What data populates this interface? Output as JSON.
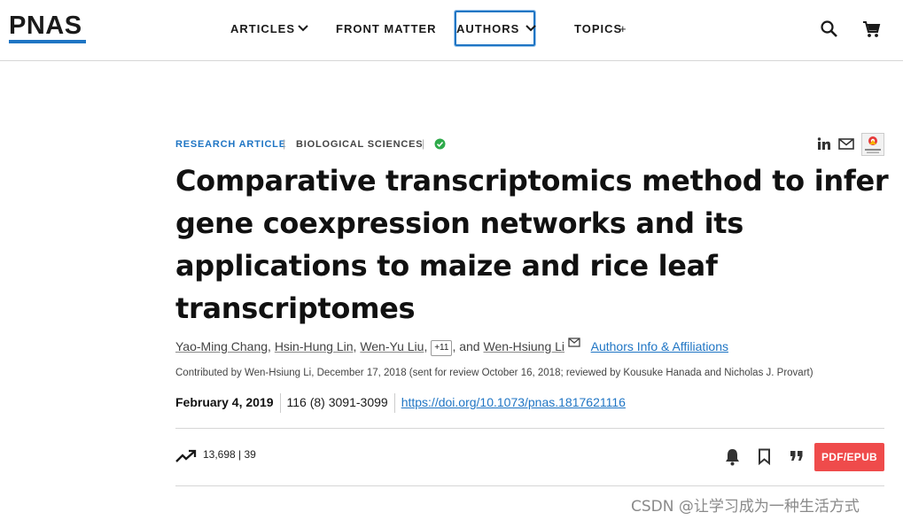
{
  "header": {
    "logo": "PNAS",
    "nav": [
      {
        "label": "ARTICLES"
      },
      {
        "label": "FRONT MATTER"
      },
      {
        "label": "AUTHORS"
      },
      {
        "label": "TOPICS"
      }
    ],
    "topics_plus": "+"
  },
  "article": {
    "type": "RESEARCH ARTICLE",
    "section": "BIOLOGICAL SCIENCES",
    "title": "Comparative transcriptomics method to infer gene coexpression networks and its applications to maize and rice leaf transcriptomes",
    "authors": [
      "Yao-Ming Chang",
      "Hsin-Hung Lin",
      "Wen-Yu Liu",
      "Wen-Hsiung Li"
    ],
    "more_authors": "+11",
    "and": ", and",
    "affiliations_link": "Authors Info & Affiliations",
    "contributed": "Contributed by Wen-Hsiung Li, December 17, 2018 (sent for review October 16, 2018; reviewed by Kousuke Hanada and Nicholas J. Provart)",
    "date": "February 4, 2019",
    "volume": "116 (8) 3091-3099",
    "doi": "https://doi.org/10.1073/pnas.1817621116",
    "views": "13,698",
    "citations": "39",
    "pdf_button": "PDF/EPUB"
  },
  "colors": {
    "accent": "#1f75c4",
    "pdf": "#ef4b4b",
    "check": "#2eaa4a"
  },
  "watermark": "CSDN @让学习成为一种生活方式"
}
